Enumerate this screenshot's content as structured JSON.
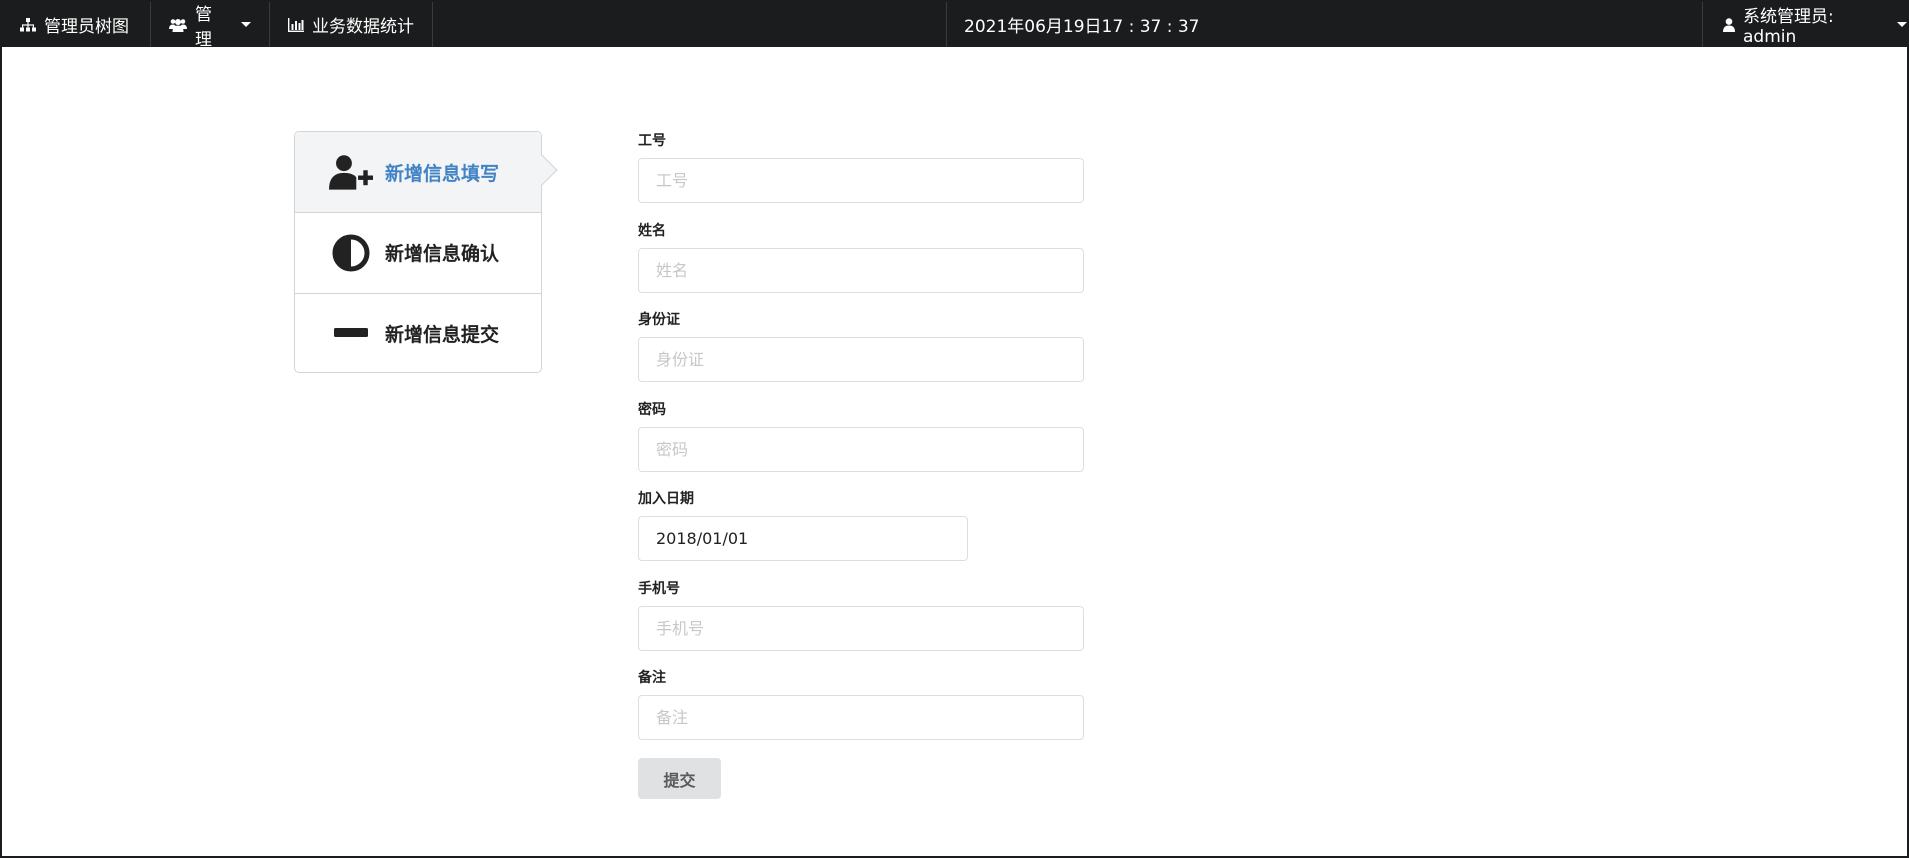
{
  "navbar": {
    "tree_label": "管理员树图",
    "manage_label": "管理",
    "stats_label": "业务数据统计",
    "datetime": "2021年06月19日17 : 37 : 37",
    "user_label": "系统管理员: admin"
  },
  "steps": [
    {
      "title": "新增信息填写",
      "icon": "add-user-icon",
      "active": true
    },
    {
      "title": "新增信息确认",
      "icon": "adjust-icon",
      "active": false
    },
    {
      "title": "新增信息提交",
      "icon": "minus-icon",
      "active": false
    }
  ],
  "form": {
    "fields": [
      {
        "label": "工号",
        "placeholder": "工号",
        "value": ""
      },
      {
        "label": "姓名",
        "placeholder": "姓名",
        "value": ""
      },
      {
        "label": "身份证",
        "placeholder": "身份证",
        "value": ""
      },
      {
        "label": "密码",
        "placeholder": "密码",
        "value": ""
      },
      {
        "label": "加入日期",
        "placeholder": "",
        "value": "2018/01/01"
      },
      {
        "label": "手机号",
        "placeholder": "手机号",
        "value": ""
      },
      {
        "label": "备注",
        "placeholder": "备注",
        "value": ""
      }
    ],
    "submit_label": "提交"
  },
  "colors": {
    "navbar_bg": "#1b1c1d",
    "active_step_text": "#4183c4",
    "button_bg": "#e0e1e2"
  }
}
